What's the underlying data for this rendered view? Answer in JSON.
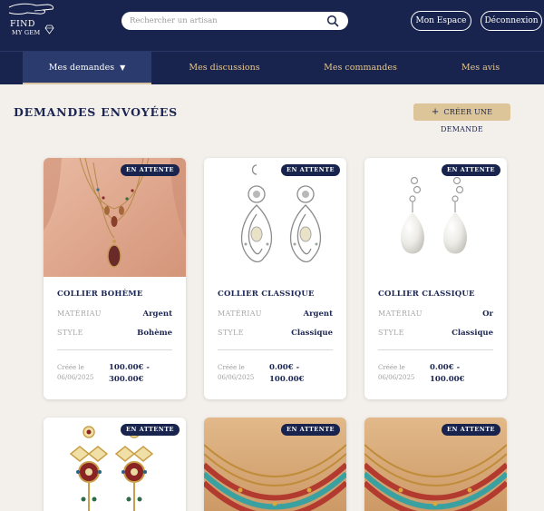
{
  "header": {
    "logo": {
      "line1": "FIND",
      "line2": "MY GEM"
    },
    "search": {
      "placeholder": "Rechercher un artisan",
      "value": ""
    },
    "buttons": {
      "mon_espace": "Mon Espace",
      "deconnexion": "Déconnexion"
    }
  },
  "nav": {
    "items": [
      {
        "label": "Mes demandes",
        "caret": "▼",
        "active": true
      },
      {
        "label": "Mes discussions",
        "active": false
      },
      {
        "label": "Mes commandes",
        "active": false
      },
      {
        "label": "Mes avis",
        "active": false
      }
    ]
  },
  "page": {
    "title": "DEMANDES ENVOYÉES",
    "create_button": {
      "icon": "plus-icon",
      "plus": "+",
      "label": "CRÉER UNE DEMANDE"
    }
  },
  "labels": {
    "material": "MATÉRIAU",
    "style": "STYLE"
  },
  "cards": [
    {
      "status": "EN ATTENTE",
      "name": "COLLIER BOHÈME",
      "material": "Argent",
      "style": "Bohème",
      "created_line1": "Créée le",
      "created_line2": "06/06/2025",
      "price_line1": "100.00€ -",
      "price_line2": "300.00€"
    },
    {
      "status": "EN ATTENTE",
      "name": "COLLIER CLASSIQUE",
      "material": "Argent",
      "style": "Classique",
      "created_line1": "Créée le",
      "created_line2": "06/06/2025",
      "price_line1": "0.00€ -",
      "price_line2": "100.00€"
    },
    {
      "status": "EN ATTENTE",
      "name": "COLLIER CLASSIQUE",
      "material": "Or",
      "style": "Classique",
      "created_line1": "Créée le",
      "created_line2": "06/06/2025",
      "price_line1": "0.00€ -",
      "price_line2": "100.00€"
    },
    {
      "status": "EN ATTENTE"
    },
    {
      "status": "EN ATTENTE"
    },
    {
      "status": "EN ATTENTE"
    }
  ],
  "colors": {
    "navy": "#18244e",
    "gold": "#dcc598",
    "nav_text": "#e7c88d",
    "background": "#f3efea"
  }
}
